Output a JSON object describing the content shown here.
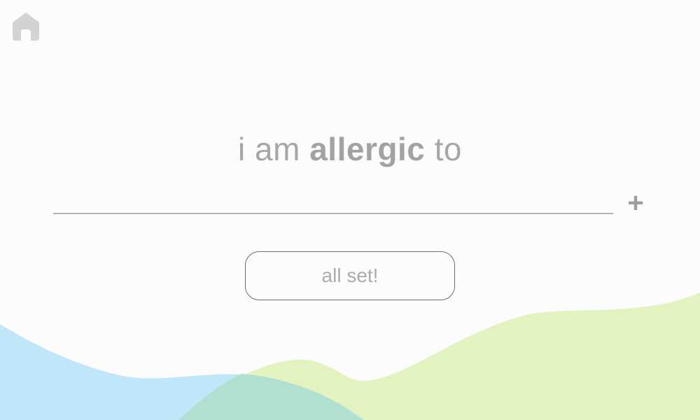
{
  "header": {
    "home_icon": "home-icon"
  },
  "prompt": {
    "prefix": "i am",
    "emphasis": "allergic",
    "suffix": "to"
  },
  "allergy_input": {
    "value": "",
    "placeholder": ""
  },
  "add_button": {
    "label": "+",
    "icon": "plus-icon"
  },
  "done_button": {
    "label": "all set!"
  },
  "colors": {
    "background": "#fcfcfc",
    "text": "#a6a6a6",
    "wave_blue": "#bfe6f9",
    "wave_green": "#e2f3c0",
    "wave_overlap": "#b0e1d0",
    "icon": "#d3d3d3"
  }
}
